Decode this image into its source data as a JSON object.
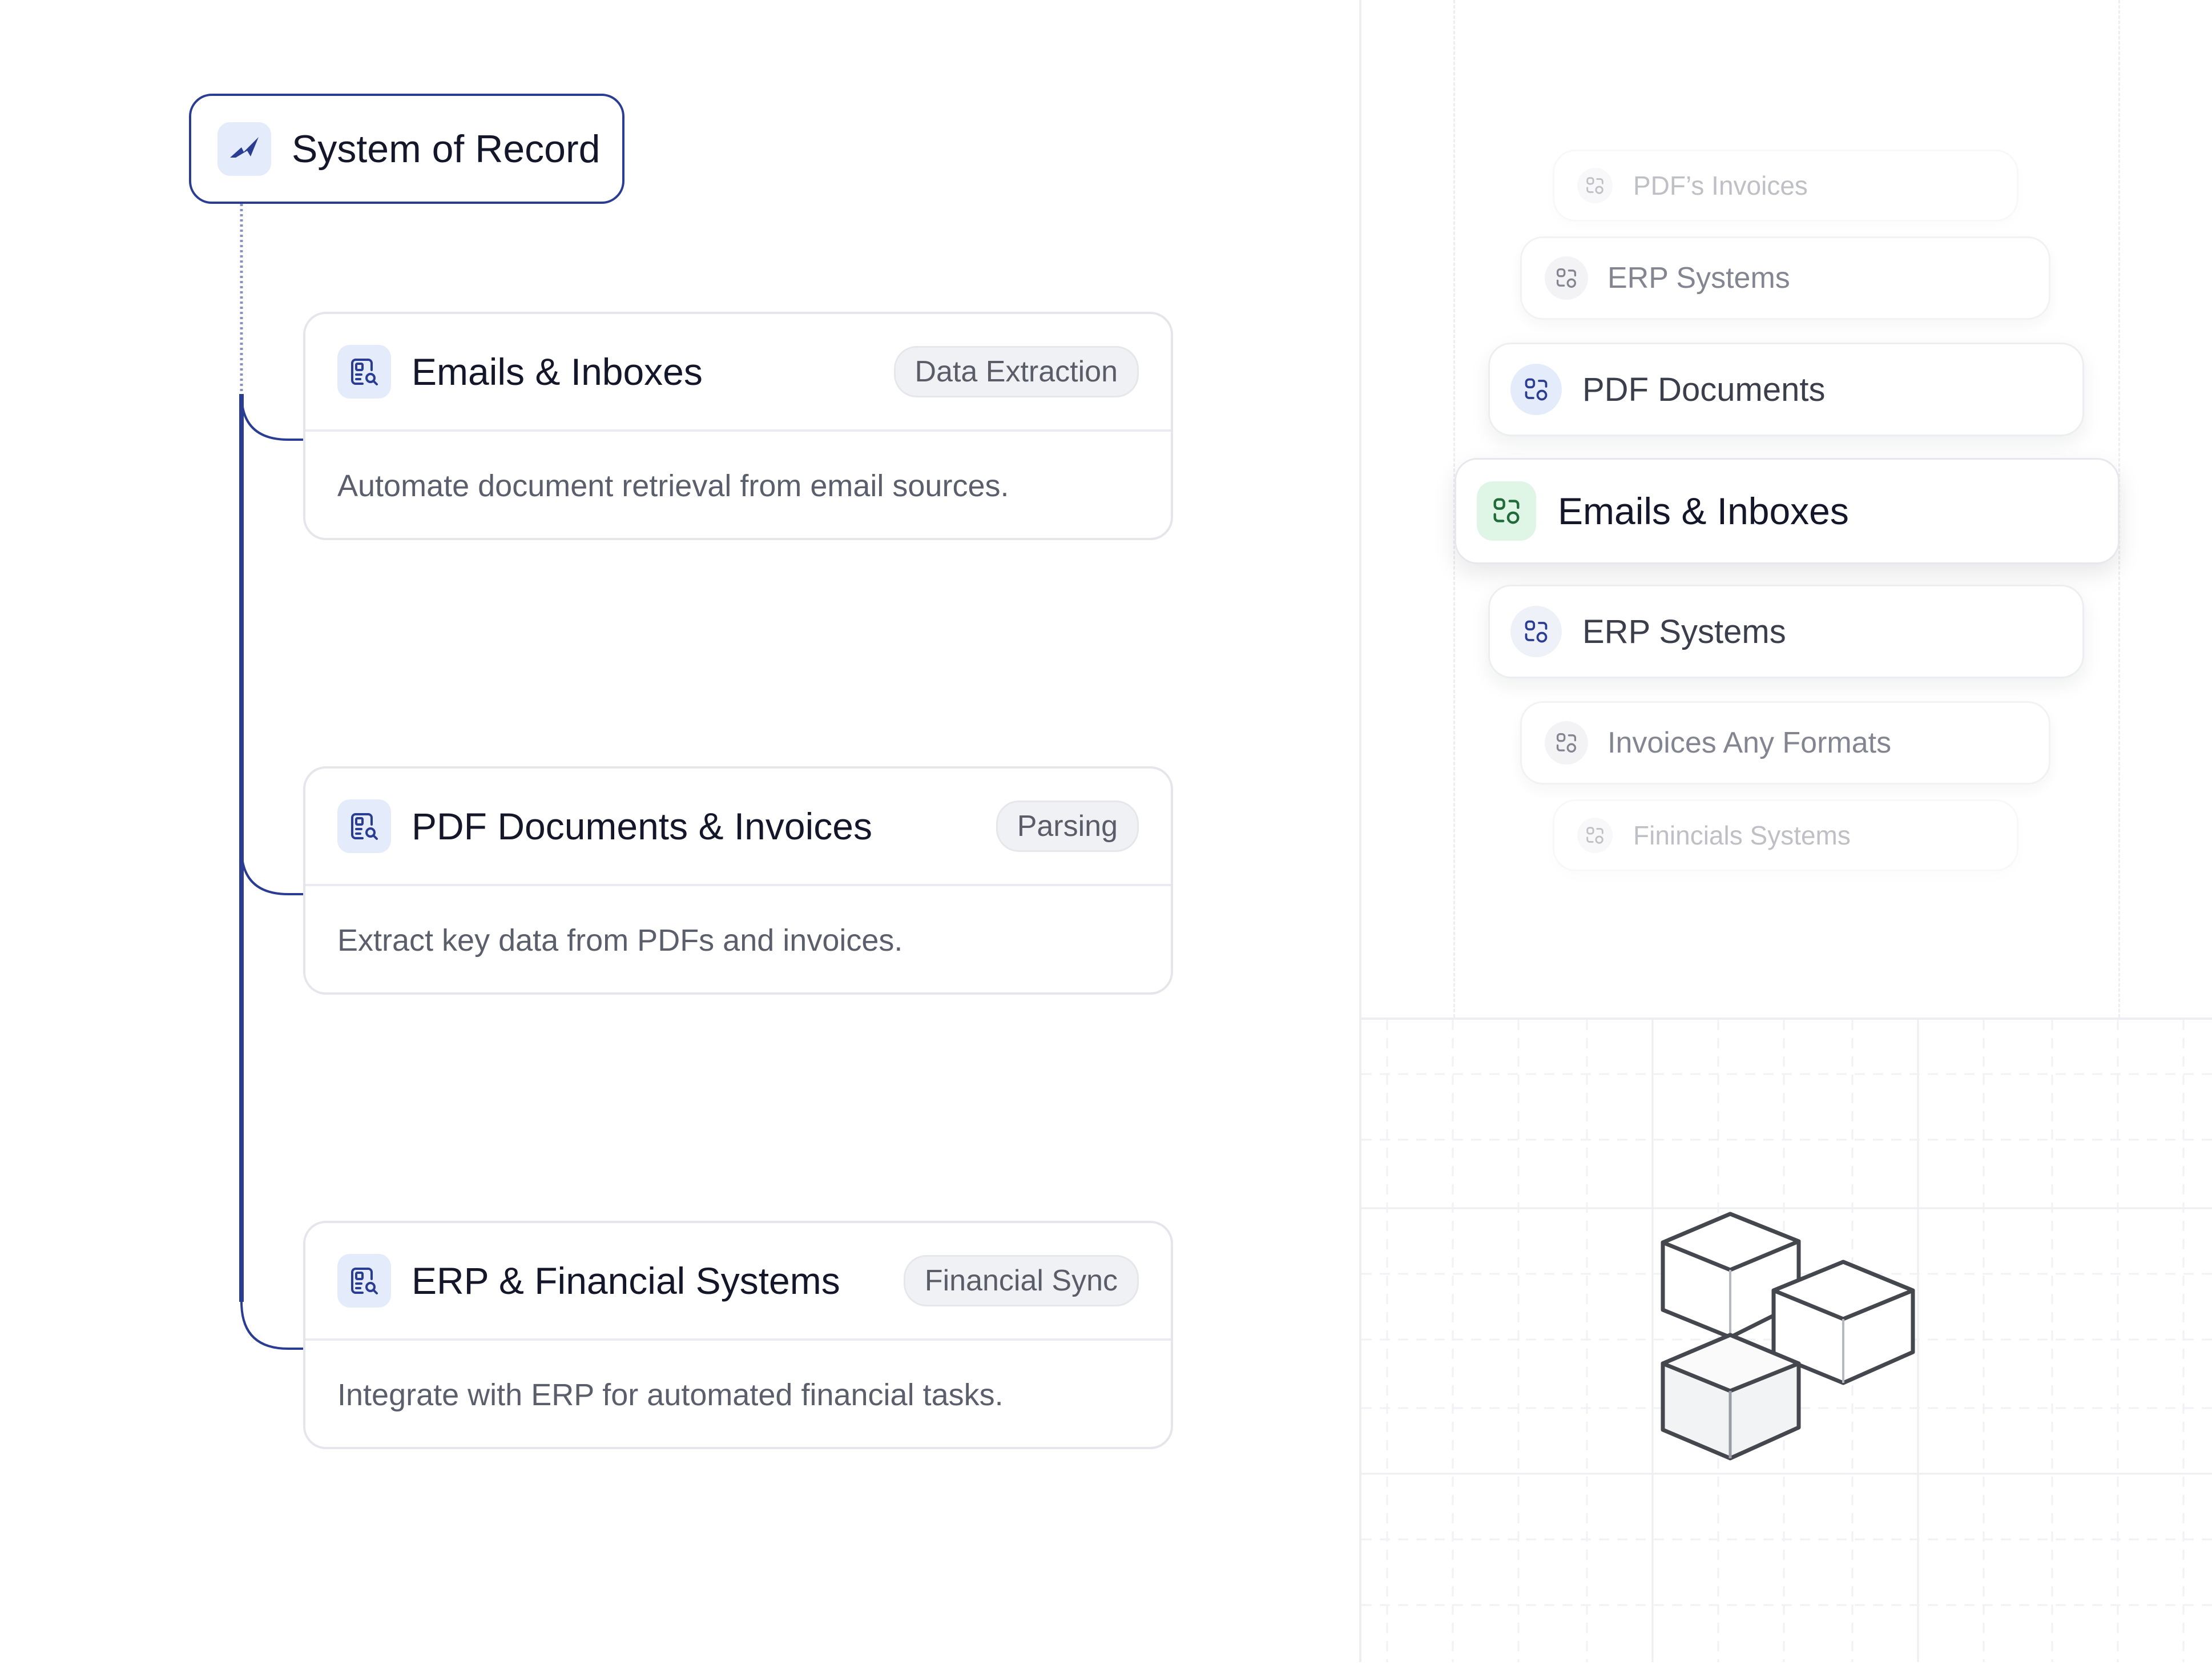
{
  "hierarchy": {
    "root": {
      "title": "System of Record",
      "icon": "bolt-icon"
    },
    "cards": [
      {
        "title": "Emails & Inboxes",
        "tag": "Data Extraction",
        "description": "Automate document retrieval from email sources.",
        "icon": "document-search-icon"
      },
      {
        "title": "PDF Documents & Invoices",
        "tag": "Parsing",
        "description": "Extract key data from PDFs and invoices.",
        "icon": "document-search-icon"
      },
      {
        "title": "ERP & Financial Systems",
        "tag": "Financial Sync",
        "description": "Integrate with ERP for automated financial tasks.",
        "icon": "document-search-icon"
      }
    ]
  },
  "source_stack": {
    "items": [
      {
        "label": "PDF’s Invoices",
        "state": "faded",
        "icon": "integration-icon"
      },
      {
        "label": "ERP Systems",
        "state": "dim",
        "icon": "integration-icon"
      },
      {
        "label": "PDF Documents",
        "state": "near",
        "icon": "integration-icon"
      },
      {
        "label": "Emails & Inboxes",
        "state": "active",
        "icon": "integration-icon"
      },
      {
        "label": "ERP Systems",
        "state": "near",
        "icon": "integration-icon"
      },
      {
        "label": "Invoices Any Formats",
        "state": "dim",
        "icon": "integration-icon"
      },
      {
        "label": "Finincials Systems",
        "state": "faded",
        "icon": "integration-icon"
      }
    ]
  },
  "illustration": {
    "icon": "cubes-icon"
  },
  "colors": {
    "accent": "#2b3d92",
    "icon_bg": "#e4ebfb",
    "active_icon_bg": "#dff5e6",
    "active_icon_fg": "#1f6b3a",
    "border": "#e4e6ec",
    "muted_text": "#5b5f6b"
  }
}
